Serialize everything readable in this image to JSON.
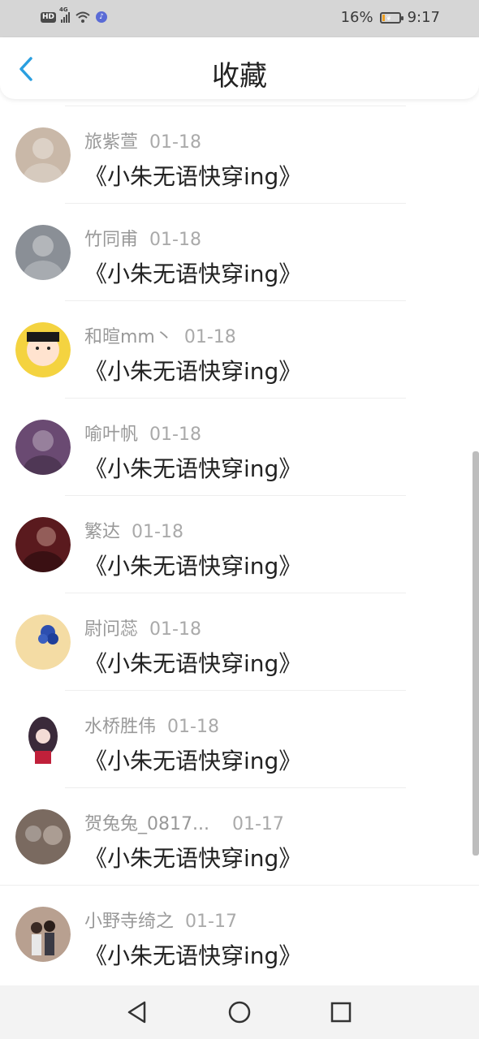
{
  "status_bar": {
    "left_icons": [
      "hd-icon",
      "signal-4g-icon",
      "wifi-icon",
      "music-app-icon"
    ],
    "hd_label": "HD",
    "network_label": "4G",
    "battery_percent": "16%",
    "time": "9:17",
    "battery_level": 0.16
  },
  "header": {
    "title": "收藏",
    "back_icon": "chevron-left-icon",
    "accent_color": "#2a9fe0"
  },
  "favorites": [
    {
      "name": "旅紫萱",
      "date": "01-18",
      "title": "《小朱无语快穿ing》",
      "avatar_color": "#c9b8a8"
    },
    {
      "name": "竹同甫",
      "date": "01-18",
      "title": "《小朱无语快穿ing》",
      "avatar_color": "#8a8f96"
    },
    {
      "name": "和暄mm丶",
      "date": "01-18",
      "title": "《小朱无语快穿ing》",
      "avatar_color": "#f4d340"
    },
    {
      "name": "喻叶帆",
      "date": "01-18",
      "title": "《小朱无语快穿ing》",
      "avatar_color": "#6a4a72"
    },
    {
      "name": "繁达",
      "date": "01-18",
      "title": "《小朱无语快穿ing》",
      "avatar_color": "#5a1a1e"
    },
    {
      "name": "尉问蕊",
      "date": "01-18",
      "title": "《小朱无语快穿ing》",
      "avatar_color": "#f4dca4"
    },
    {
      "name": "水桥胜伟",
      "date": "01-18",
      "title": "《小朱无语快穿ing》",
      "avatar_color": "#3a2a3a"
    },
    {
      "name": "贺兔兔_0817...",
      "date": "01-17",
      "title": "《小朱无语快穿ing》",
      "avatar_color": "#7a6a60"
    },
    {
      "name": "小野寺绮之",
      "date": "01-17",
      "title": "《小朱无语快穿ing》",
      "avatar_color": "#b8a090"
    }
  ],
  "nav_bar": {
    "icons": [
      "back-triangle-icon",
      "home-circle-icon",
      "recents-square-icon"
    ]
  }
}
